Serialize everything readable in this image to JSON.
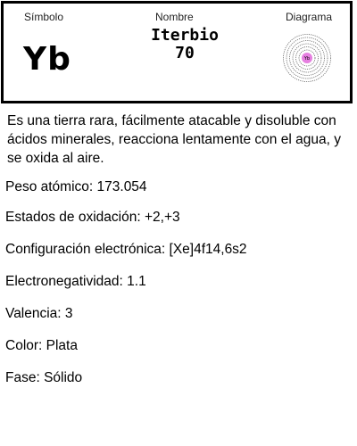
{
  "header": {
    "symbol_label": "Símbolo",
    "name_label": "Nombre",
    "diagram_label": "Diagrama"
  },
  "element": {
    "symbol": "Yb",
    "name": "Iterbio",
    "atomic_number": "70",
    "diagram_nucleus_label": "Yb"
  },
  "description": "Es una tierra rara, fácilmente atacable y disoluble con ácidos minerales, reacciona lentamente con el agua, y se oxida al aire.",
  "properties": [
    "Peso atómico: 173.054",
    "Estados de oxidación: +2,+3",
    "Configuración electrónica: [Xe]4f14,6s2",
    "Electronegatividad: 1.1",
    "Valencia: 3",
    "Color: Plata",
    "Fase: Sólido"
  ],
  "colors": {
    "nucleus": "#e67fe0",
    "shells": "#666666"
  }
}
